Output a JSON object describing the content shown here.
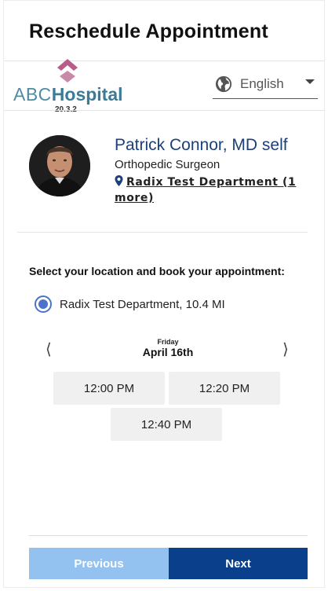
{
  "header": {
    "title": "Reschedule Appointment"
  },
  "logo": {
    "name_part1": "ABC",
    "name_part2": "Hospital",
    "version": "20.3.2"
  },
  "language": {
    "selected": "English",
    "icon": "globe-icon"
  },
  "doctor": {
    "name": "Patrick Connor, MD self",
    "specialty": "Orthopedic Surgeon",
    "department_link": "Radix Test Department (1 more)",
    "location_icon": "map-pin-icon"
  },
  "booking": {
    "prompt": "Select your location and book your appointment:",
    "location_option": "Radix Test Department, 10.4 MI",
    "prev_day": "⟨",
    "next_day": "⟩",
    "weekday": "Friday",
    "date": "April 16th",
    "slots": [
      "12:00 PM",
      "12:20 PM",
      "12:40 PM"
    ]
  },
  "footer": {
    "previous_label": "Previous",
    "next_label": "Next"
  },
  "colors": {
    "accent": "#0a3f8c",
    "accent_light": "#93c2f1",
    "doctor_name": "#1d3f7a",
    "radio": "#4a73c9",
    "slot_bg": "#f0f0f0",
    "logo_mark": "#b85d8a"
  }
}
